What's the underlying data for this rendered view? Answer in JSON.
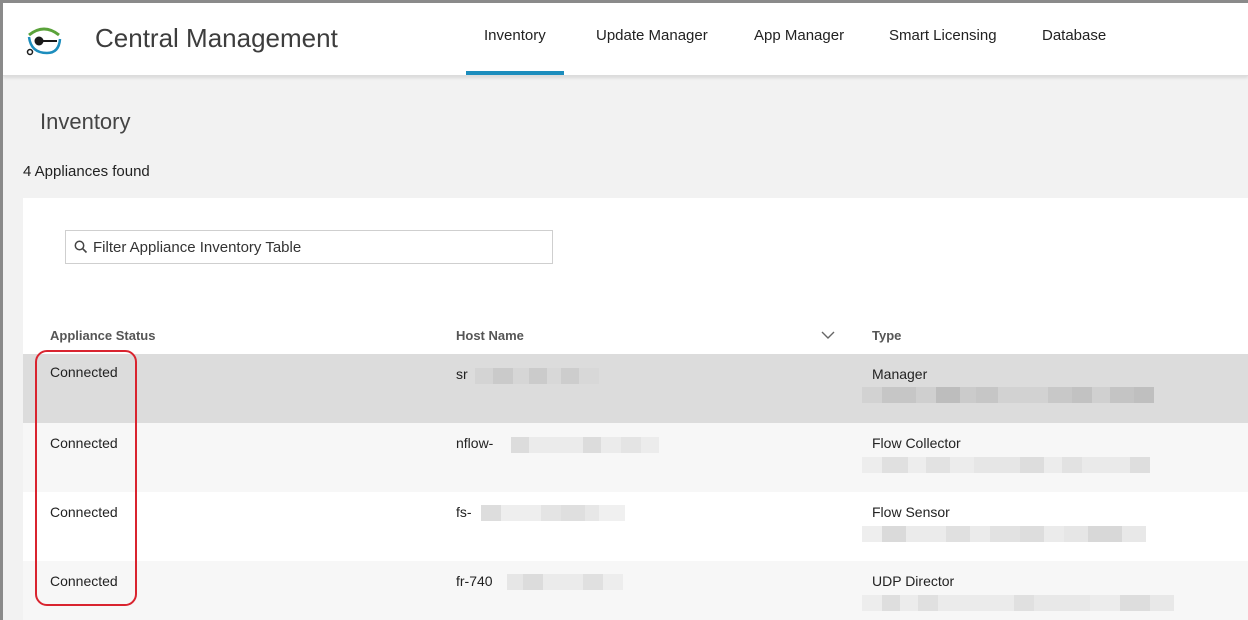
{
  "app": {
    "title": "Central Management",
    "logo_icon": "cisco-stealthwatch-logo-icon"
  },
  "nav": {
    "tabs": [
      {
        "label": "Inventory",
        "active": true
      },
      {
        "label": "Update Manager",
        "active": false
      },
      {
        "label": "App Manager",
        "active": false
      },
      {
        "label": "Smart Licensing",
        "active": false
      },
      {
        "label": "Database",
        "active": false
      }
    ],
    "active_color": "#1c8dbd"
  },
  "page": {
    "title": "Inventory",
    "count_text": "4 Appliances found"
  },
  "filter": {
    "placeholder": "Filter Appliance Inventory Table",
    "icon": "search-icon"
  },
  "table": {
    "columns": [
      "Appliance Status",
      "Host Name",
      "Type"
    ],
    "sort_icon": "chevron-down-icon",
    "rows": [
      {
        "status": "Connected",
        "host": "sr",
        "type": "Manager",
        "selected": true
      },
      {
        "status": "Connected",
        "host": "nflow-",
        "type": "Flow Collector",
        "selected": false
      },
      {
        "status": "Connected",
        "host": "fs-",
        "type": "Flow Sensor",
        "selected": false
      },
      {
        "status": "Connected",
        "host": "fr-740",
        "type": "UDP Director",
        "selected": false
      }
    ]
  },
  "colors": {
    "selected_row": "#dcdcdc",
    "alt_row": "#f7f7f7",
    "annotation": "#d9242f"
  }
}
